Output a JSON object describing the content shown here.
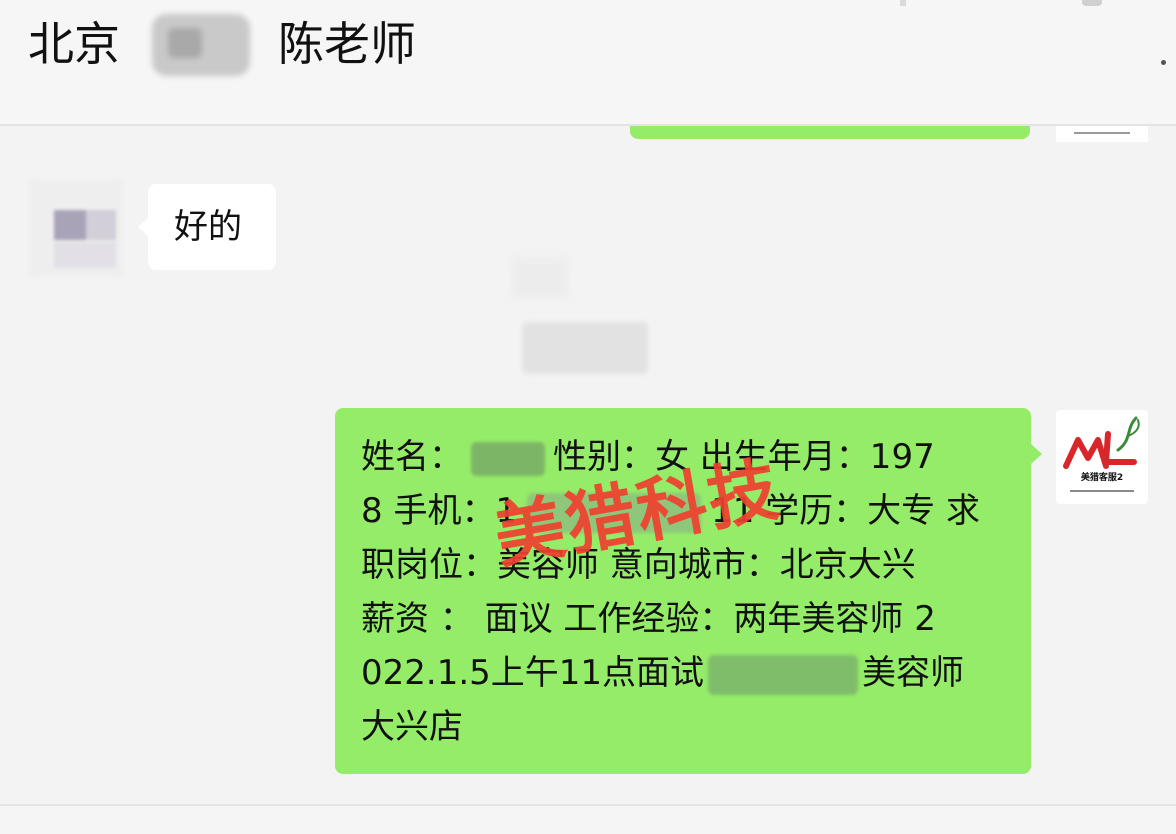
{
  "header": {
    "city": "北京",
    "name": "陈老师"
  },
  "messages": {
    "incoming": {
      "text": "好的"
    },
    "outgoing": {
      "line1_a": "姓名：",
      "line1_b": "性别：女 出生年月：197",
      "line2_a": "8 手机：1",
      "line2_b": "11 学历：大专 求",
      "line3": "职岗位：美容师 意向城市：北京大兴",
      "line4": "薪资 ： 面议 工作经验：两年美容师 2",
      "line5_a": "022.1.5上午11点面试",
      "line5_b": "美容师",
      "line6": "大兴店"
    }
  },
  "watermark": "美猎科技",
  "avatar": {
    "logo_icon": "ml-logo-icon",
    "caption": "美猎客服2",
    "accent_red": "#d9262b",
    "accent_green": "#3a8a3a"
  },
  "colors": {
    "outgoing_bubble": "#95ec69",
    "incoming_bubble": "#ffffff",
    "background": "#f3f3f3",
    "watermark": "#f0402f"
  }
}
